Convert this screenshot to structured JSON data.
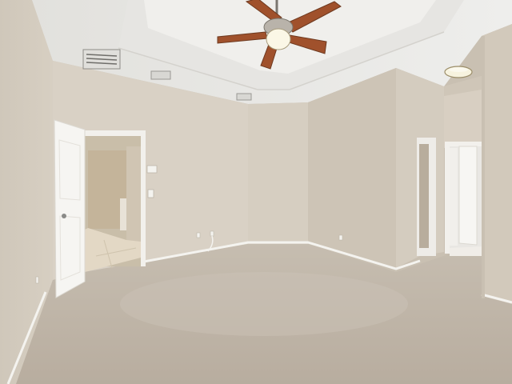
{
  "scene": {
    "type": "photo",
    "subject": "empty-bedroom",
    "colors": {
      "wall_light": "#d9d2c6",
      "wall_mid": "#cec6b8",
      "wall_shadow": "#bdb4a6",
      "ceiling": "#ecebe8",
      "carpet": "#bfb5a7",
      "carpet_light": "#cfc6ba",
      "trim": "#f4f3ef",
      "fan_blade": "#a0512c",
      "tile": "#e3d8c5"
    }
  }
}
